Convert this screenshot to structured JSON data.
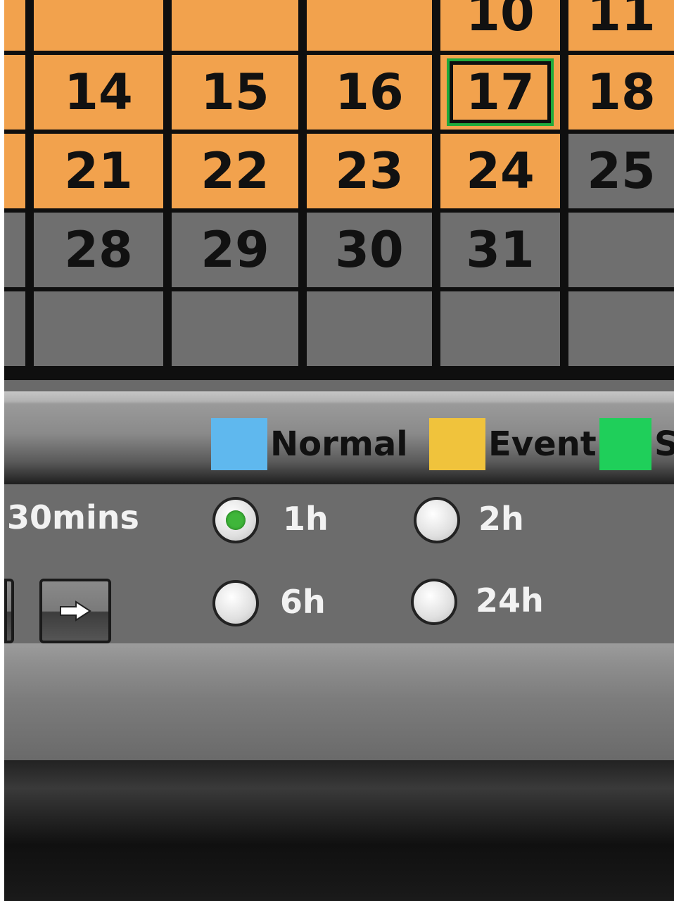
{
  "calendar": {
    "rows": [
      [
        "",
        "",
        "",
        "10",
        "11"
      ],
      [
        "14",
        "15",
        "16",
        "17",
        "18"
      ],
      [
        "21",
        "22",
        "23",
        "24",
        "25"
      ],
      [
        "28",
        "29",
        "30",
        "31",
        ""
      ],
      [
        "",
        "",
        "",
        "",
        ""
      ]
    ],
    "today": "17"
  },
  "legend": [
    {
      "label": "Normal",
      "color": "#5fb8ee"
    },
    {
      "label": "Event",
      "color": "#f0c33c"
    },
    {
      "label": "S",
      "color": "#1fcf5a"
    }
  ],
  "durations": {
    "partial_label": "30mins",
    "options": [
      {
        "label": "1h",
        "selected": true
      },
      {
        "label": "2h",
        "selected": false
      },
      {
        "label": "6h",
        "selected": false
      },
      {
        "label": "24h",
        "selected": false
      }
    ]
  },
  "colors": {
    "recorded_day": "#f2a24d",
    "empty_day": "#6f6f6f",
    "today_outline": "#1faa3c",
    "selected_dot": "#3fb63a"
  },
  "icons": {
    "next": "right-arrow-icon"
  }
}
